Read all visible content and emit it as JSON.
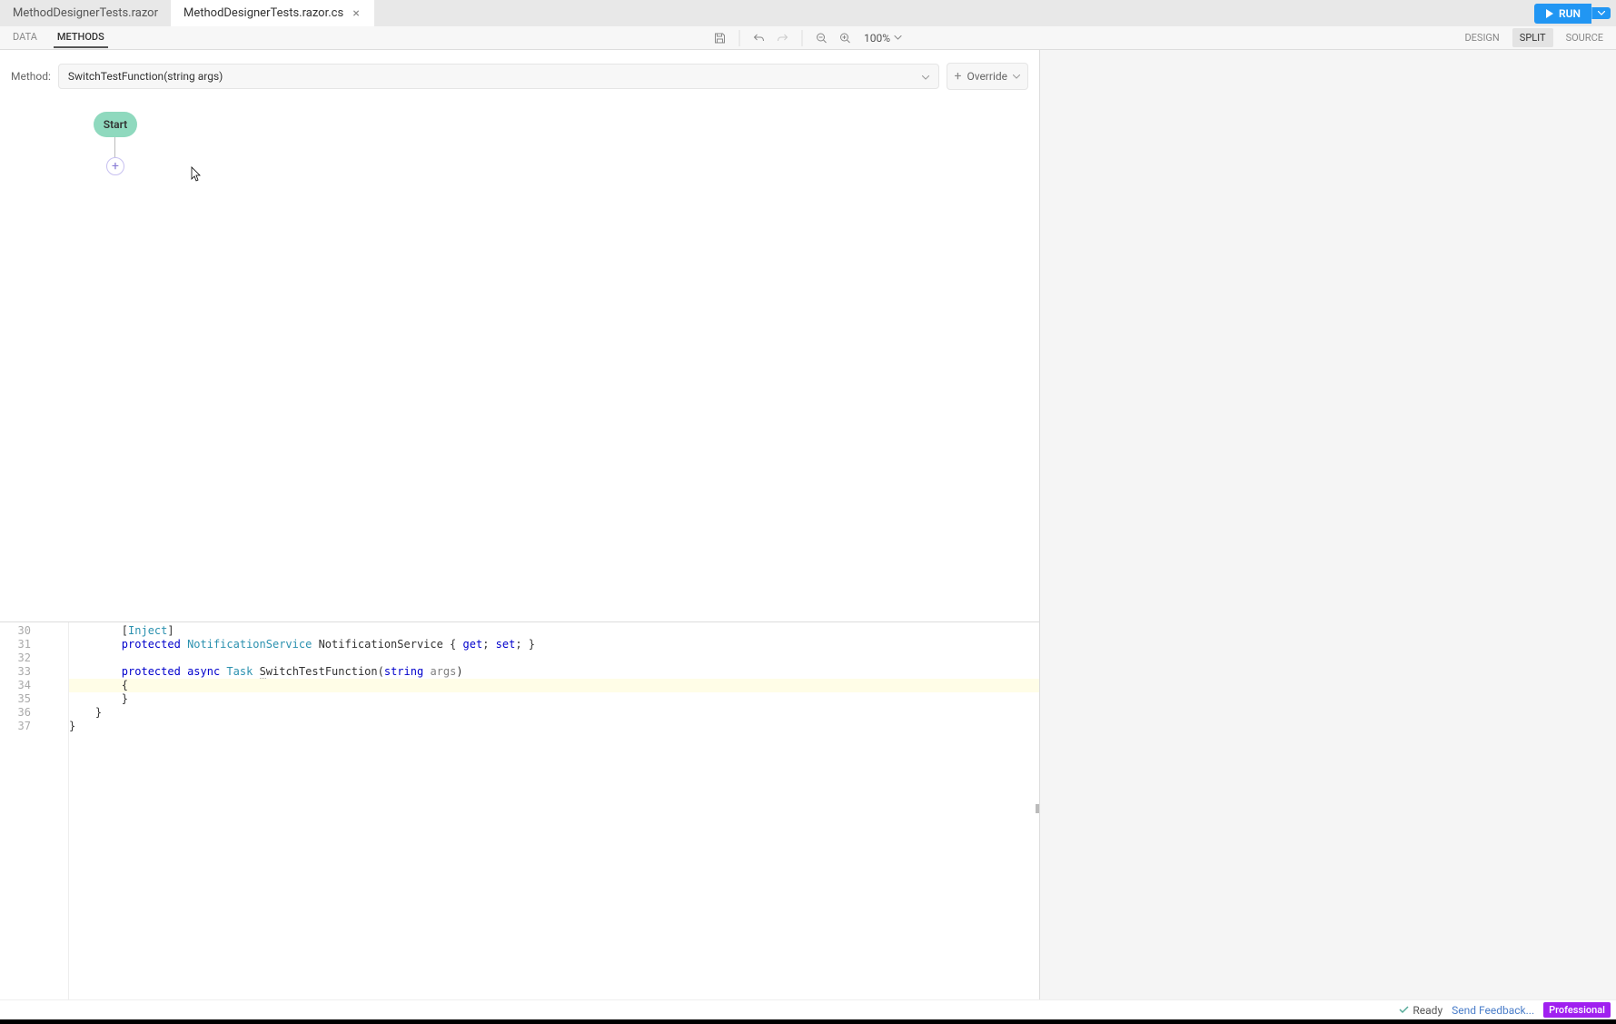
{
  "tabs": [
    {
      "label": "MethodDesignerTests.razor",
      "active": false
    },
    {
      "label": "MethodDesignerTests.razor.cs",
      "active": true
    }
  ],
  "run": {
    "label": "RUN"
  },
  "toolbar": {
    "left": [
      "DATA",
      "METHODS"
    ],
    "activeLeft": 1,
    "zoom": "100%",
    "right": [
      "DESIGN",
      "SPLIT",
      "SOURCE"
    ],
    "activeRight": 1
  },
  "methodBar": {
    "label": "Method:",
    "selected": "SwitchTestFunction(string args)",
    "override": "Override"
  },
  "designer": {
    "startLabel": "Start",
    "plus": "+"
  },
  "code": {
    "startLine": 30,
    "lines": [
      {
        "num": 30,
        "html": "        [<span class='attr'>Inject</span>]"
      },
      {
        "num": 31,
        "html": "        <span class='kw'>protected</span> <span class='type'>NotificationService</span> NotificationService { <span class='kw'>get</span>; <span class='kw'>set</span>; }"
      },
      {
        "num": 32,
        "html": ""
      },
      {
        "num": 33,
        "html": "        <span class='kw'>protected</span> <span class='kw'>async</span> <span class='type'>Task</span> <span style='border-bottom:1px dotted #aaa'>S</span>witchTestFunction(<span class='kw'>string</span> <span class='param'>args</span>)"
      },
      {
        "num": 34,
        "html": "        {",
        "hl": true
      },
      {
        "num": 35,
        "html": "        }"
      },
      {
        "num": 36,
        "html": "    }"
      },
      {
        "num": 37,
        "html": "}"
      }
    ]
  },
  "status": {
    "ready": "Ready",
    "feedback": "Send Feedback...",
    "badge": "Professional"
  }
}
